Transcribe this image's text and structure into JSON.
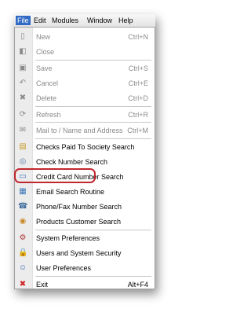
{
  "menubar": {
    "items": [
      {
        "label": "File",
        "active": true
      },
      {
        "label": "Edit",
        "active": false
      },
      {
        "label": "Modules",
        "active": false
      },
      {
        "label": "Window",
        "active": false
      },
      {
        "label": "Help",
        "active": false
      }
    ]
  },
  "file_menu": {
    "items": [
      {
        "label": "New",
        "shortcut": "Ctrl+N",
        "icon": "new-document-icon",
        "glyph": "▯",
        "color": "#8a8a8a",
        "enabled": false
      },
      {
        "label": "Close",
        "shortcut": "",
        "icon": "close-document-icon",
        "glyph": "◧",
        "color": "#8a8a8a",
        "enabled": false
      },
      {
        "label": "Save",
        "shortcut": "Ctrl+S",
        "icon": "save-icon",
        "glyph": "▣",
        "color": "#8a8a8a",
        "enabled": false
      },
      {
        "label": "Cancel",
        "shortcut": "Ctrl+E",
        "icon": "undo-icon",
        "glyph": "↶",
        "color": "#8a8a8a",
        "enabled": false
      },
      {
        "label": "Delete",
        "shortcut": "Ctrl+D",
        "icon": "delete-icon",
        "glyph": "✖",
        "color": "#8a8a8a",
        "enabled": false
      },
      {
        "label": "Refresh",
        "shortcut": "Ctrl+R",
        "icon": "refresh-icon",
        "glyph": "⟳",
        "color": "#8a8a8a",
        "enabled": false
      },
      {
        "label": "Mail to / Name and Address",
        "shortcut": "Ctrl+M",
        "icon": "mail-icon",
        "glyph": "✉",
        "color": "#8a8a8a",
        "enabled": false
      },
      {
        "label": "Checks Paid To Society Search",
        "shortcut": "",
        "icon": "checks-icon",
        "glyph": "▤",
        "color": "#c89a2a",
        "enabled": true
      },
      {
        "label": "Check Number Search",
        "shortcut": "",
        "icon": "magnifier-icon",
        "glyph": "◎",
        "color": "#5a7aa8",
        "enabled": true
      },
      {
        "label": "Credit Card Number Search",
        "shortcut": "",
        "icon": "credit-card-icon",
        "glyph": "▭",
        "color": "#3a6ab8",
        "enabled": true
      },
      {
        "label": "Email Search Routine",
        "shortcut": "",
        "icon": "email-search-icon",
        "glyph": "▦",
        "color": "#3a76b8",
        "enabled": true
      },
      {
        "label": "Phone/Fax Number Search",
        "shortcut": "",
        "icon": "phone-icon",
        "glyph": "☎",
        "color": "#3a6a9a",
        "enabled": true
      },
      {
        "label": "Products Customer Search",
        "shortcut": "",
        "icon": "products-icon",
        "glyph": "◉",
        "color": "#c88a2a",
        "enabled": true
      },
      {
        "label": "System Preferences",
        "shortcut": "",
        "icon": "system-preferences-icon",
        "glyph": "⚙",
        "color": "#b03a3a",
        "enabled": true
      },
      {
        "label": "Users and System Security",
        "shortcut": "",
        "icon": "lock-icon",
        "glyph": "🔒",
        "color": "#d4a020",
        "enabled": true
      },
      {
        "label": "User Preferences",
        "shortcut": "",
        "icon": "user-icon",
        "glyph": "☺",
        "color": "#3a6ab8",
        "enabled": true
      },
      {
        "label": "Exit",
        "shortcut": "Alt+F4",
        "icon": "exit-icon",
        "glyph": "✖",
        "color": "#d02020",
        "enabled": true
      }
    ]
  }
}
